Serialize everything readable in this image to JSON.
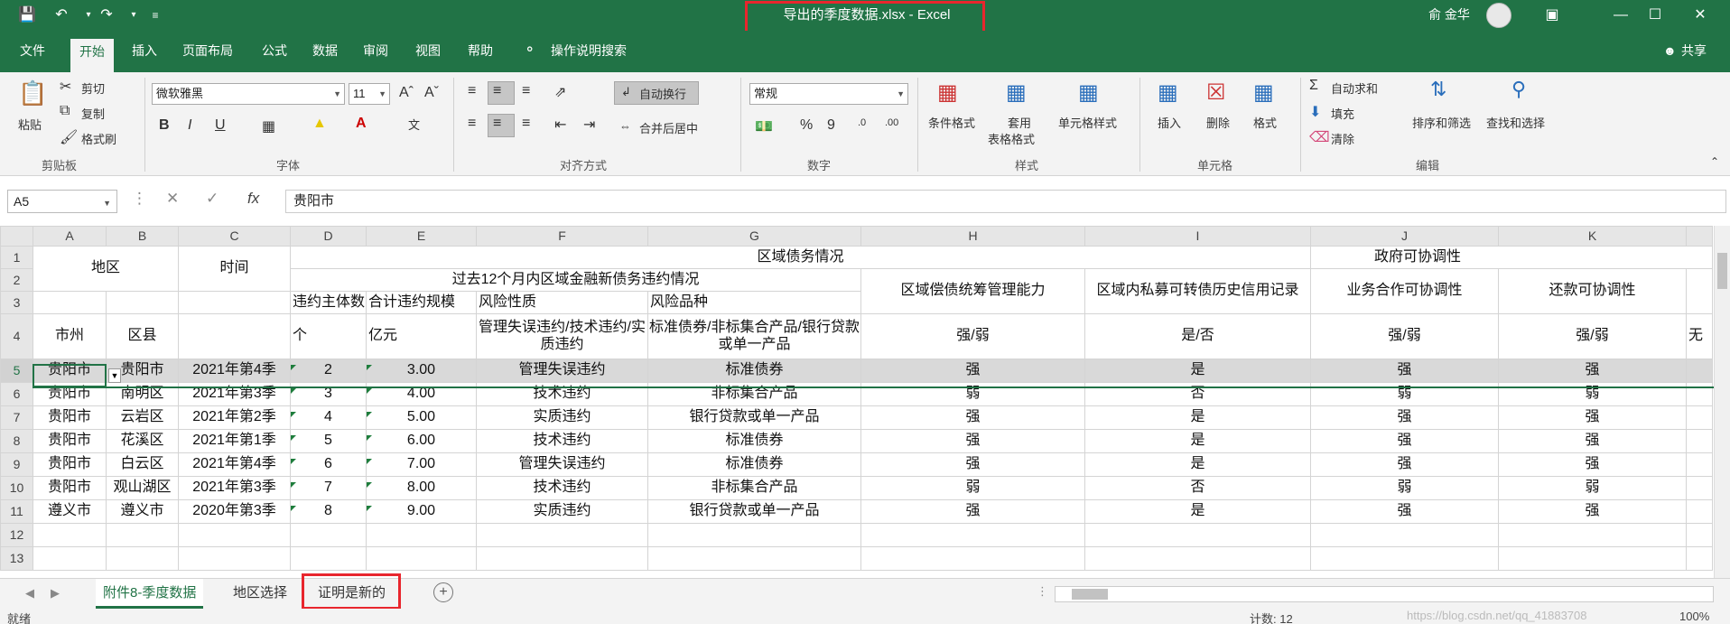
{
  "window": {
    "title": "导出的季度数据.xlsx  -  Excel",
    "user_name": "俞 金华",
    "share_label": "共享"
  },
  "ribbon_tabs": [
    "文件",
    "开始",
    "插入",
    "页面布局",
    "公式",
    "数据",
    "审阅",
    "视图",
    "帮助",
    "操作说明搜索"
  ],
  "ribbon": {
    "clipboard": {
      "paste": "粘贴",
      "cut": "剪切",
      "copy": "复制",
      "format_painter": "格式刷",
      "group": "剪贴板"
    },
    "font": {
      "name": "微软雅黑",
      "size": "11",
      "bold": "B",
      "italic": "I",
      "underline": "U",
      "group": "字体"
    },
    "alignment": {
      "wrap": "自动换行",
      "merge": "合并后居中",
      "group": "对齐方式"
    },
    "number": {
      "format": "常规",
      "percent": "%",
      "comma": "9",
      "group": "数字"
    },
    "styles": {
      "conditional": "条件格式",
      "table1": "套用",
      "table2": "表格格式",
      "cell_styles": "单元格样式",
      "group": "样式"
    },
    "cells": {
      "insert": "插入",
      "delete": "删除",
      "format": "格式",
      "group": "单元格"
    },
    "editing": {
      "autosum": "自动求和",
      "fill": "填充",
      "clear": "清除",
      "sort_filter": "排序和筛选",
      "find_select": "查找和选择",
      "group": "编辑"
    }
  },
  "formula_bar": {
    "name_box": "A5",
    "fx": "fx",
    "value": "贵阳市"
  },
  "columns": [
    "A",
    "B",
    "C",
    "D",
    "E",
    "F",
    "G",
    "H",
    "I",
    "J",
    "K"
  ],
  "rows": [
    "1",
    "2",
    "3",
    "4",
    "5",
    "6",
    "7",
    "8",
    "9",
    "10",
    "11",
    "12",
    "13"
  ],
  "headers": {
    "region": "地区",
    "time": "时间",
    "debt_situation": "区域债务情况",
    "gov_coord": "政府可协调性",
    "default_12m": "过去12个月内区域金融新债务违约情况",
    "default_entity": "违约主体数",
    "default_total": "合计违约规模",
    "risk_nature": "风险性质",
    "risk_type": "风险品种",
    "repay_ability": "区域偿债统筹管理能力",
    "private_convert": "区域内私募可转债历史信用记录",
    "biz_coord": "业务合作可协调性",
    "repay_coord": "还款可协调性",
    "city": "市州",
    "county": "区县",
    "unit_count": "个",
    "unit_amount": "亿元",
    "risk_nature_opts": "管理失误违约/技术违约/实质违约",
    "risk_type_opts": "标准债券/非标集合产品/银行贷款或单一产品",
    "strong_weak": "强/弱",
    "yes_no": "是/否",
    "l_partial": "无"
  },
  "data_rows": [
    {
      "city": "贵阳市",
      "county": "贵阳市",
      "time": "2021年第4季",
      "count": "2",
      "amount": "3.00",
      "nature": "管理失误违约",
      "type": "标准债券",
      "h": "强",
      "i": "是",
      "j": "强",
      "k": "强"
    },
    {
      "city": "贵阳市",
      "county": "南明区",
      "time": "2021年第3季",
      "count": "3",
      "amount": "4.00",
      "nature": "技术违约",
      "type": "非标集合产品",
      "h": "弱",
      "i": "否",
      "j": "弱",
      "k": "弱"
    },
    {
      "city": "贵阳市",
      "county": "云岩区",
      "time": "2021年第2季",
      "count": "4",
      "amount": "5.00",
      "nature": "实质违约",
      "type": "银行贷款或单一产品",
      "h": "强",
      "i": "是",
      "j": "强",
      "k": "强"
    },
    {
      "city": "贵阳市",
      "county": "花溪区",
      "time": "2021年第1季",
      "count": "5",
      "amount": "6.00",
      "nature": "技术违约",
      "type": "标准债券",
      "h": "强",
      "i": "是",
      "j": "强",
      "k": "强"
    },
    {
      "city": "贵阳市",
      "county": "白云区",
      "time": "2021年第4季",
      "count": "6",
      "amount": "7.00",
      "nature": "管理失误违约",
      "type": "标准债券",
      "h": "强",
      "i": "是",
      "j": "强",
      "k": "强"
    },
    {
      "city": "贵阳市",
      "county": "观山湖区",
      "time": "2021年第3季",
      "count": "7",
      "amount": "8.00",
      "nature": "技术违约",
      "type": "非标集合产品",
      "h": "弱",
      "i": "否",
      "j": "弱",
      "k": "弱"
    },
    {
      "city": "遵义市",
      "county": "遵义市",
      "time": "2020年第3季",
      "count": "8",
      "amount": "9.00",
      "nature": "实质违约",
      "type": "银行贷款或单一产品",
      "h": "强",
      "i": "是",
      "j": "强",
      "k": "强"
    }
  ],
  "sheet_tabs": [
    "附件8-季度数据",
    "地区选择",
    "证明是新的"
  ],
  "status": {
    "ready": "就绪",
    "count": "计数: 12",
    "watermark": "https://blog.csdn.net/qq_41883708",
    "zoom": "100%"
  },
  "colors": {
    "excel_green": "#217346",
    "highlight_red": "#e8262d"
  }
}
